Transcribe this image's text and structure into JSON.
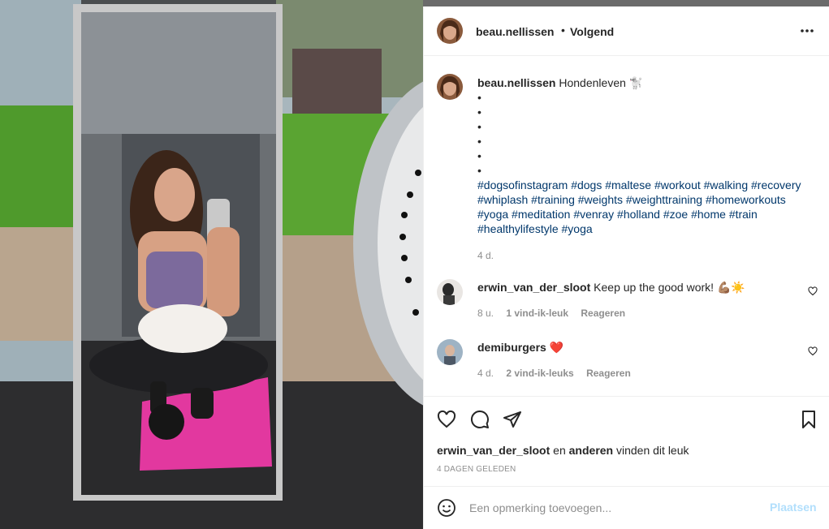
{
  "post": {
    "author": "beau.nellissen",
    "follow_status": "Volgend",
    "separator": "•",
    "caption_text": "Hondenleven 🐩",
    "bullet_count": 6,
    "hashtags": [
      "#dogsofinstagram",
      "#dogs",
      "#maltese",
      "#workout",
      "#walking",
      "#recovery",
      "#whiplash",
      "#training",
      "#weights",
      "#weighttraining",
      "#homeworkouts",
      "#yoga",
      "#meditation",
      "#venray",
      "#holland",
      "#zoe",
      "#home",
      "#train",
      "#healthylifestyle",
      "#yoga"
    ],
    "time_ago": "4 d."
  },
  "comments": [
    {
      "user": "erwin_van_der_sloot",
      "text": "Keep up the good work! 💪🏽☀️",
      "time": "8 u.",
      "likes": "1 vind-ik-leuk",
      "reply": "Reageren"
    },
    {
      "user": "demiburgers",
      "text": "❤️",
      "time": "4 d.",
      "likes": "2 vind-ik-leuks",
      "reply": "Reageren"
    }
  ],
  "likes": {
    "user": "erwin_van_der_sloot",
    "joiner": "en",
    "others": "anderen",
    "suffix": "vinden dit leuk"
  },
  "date_label": "4 DAGEN GELEDEN",
  "add_comment": {
    "placeholder": "Een opmerking toevoegen...",
    "post_label": "Plaatsen"
  },
  "icons": {
    "more": "more-horizontal-icon",
    "like": "heart-icon",
    "comment": "comment-bubble-icon",
    "share": "paper-plane-icon",
    "save": "bookmark-icon",
    "emoji": "smiley-icon"
  },
  "colors": {
    "hashtag": "#00376b",
    "muted": "#8e8e8e",
    "post_button": "#b2dffc",
    "text": "#262626"
  }
}
